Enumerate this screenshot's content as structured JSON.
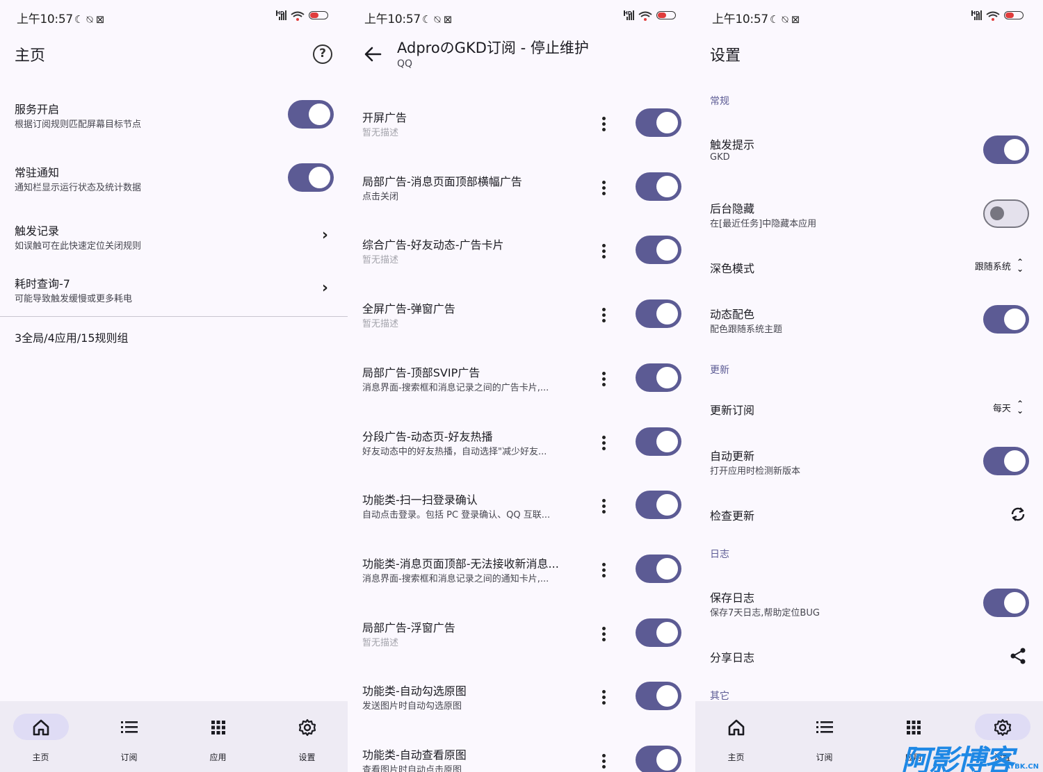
{
  "status": {
    "time": "上午10:57",
    "icons": "☾ ⍉ ⊠"
  },
  "screen1": {
    "title": "主页",
    "rows": [
      {
        "title": "服务开启",
        "sub": "根据订阅规则匹配屏幕目标节点",
        "control": "toggle-on"
      },
      {
        "title": "常驻通知",
        "sub": "通知栏显示运行状态及统计数据",
        "control": "toggle-on"
      },
      {
        "title": "触发记录",
        "sub": "如误触可在此快速定位关闭规则",
        "control": "chevron"
      },
      {
        "title": "耗时查询-7",
        "sub": "可能导致触发缓慢或更多耗电",
        "control": "chevron"
      }
    ],
    "summary": "3全局/4应用/15规则组"
  },
  "nav": {
    "items": [
      {
        "label": "主页",
        "icon": "home-icon"
      },
      {
        "label": "订阅",
        "icon": "list-icon"
      },
      {
        "label": "应用",
        "icon": "apps-grid-icon"
      },
      {
        "label": "设置",
        "icon": "settings-gear-icon"
      }
    ]
  },
  "screen2": {
    "title": "AdproのGKD订阅 - 停止维护",
    "subtitle": "QQ",
    "rules": [
      {
        "title": "开屏广告",
        "sub": "暂无描述",
        "grey": true
      },
      {
        "title": "局部广告-消息页面顶部横幅广告",
        "sub": "点击关闭",
        "grey": false
      },
      {
        "title": "综合广告-好友动态-广告卡片",
        "sub": "暂无描述",
        "grey": true
      },
      {
        "title": "全屏广告-弹窗广告",
        "sub": "暂无描述",
        "grey": true
      },
      {
        "title": "局部广告-顶部SVIP广告",
        "sub": "消息界面-搜索框和消息记录之间的广告卡片,...",
        "grey": false
      },
      {
        "title": "分段广告-动态页-好友热播",
        "sub": "好友动态中的好友热播，自动选择\"减少好友...",
        "grey": false
      },
      {
        "title": "功能类-扫一扫登录确认",
        "sub": "自动点击登录。包括 PC 登录确认、QQ 互联...",
        "grey": false
      },
      {
        "title": "功能类-消息页面顶部-无法接收新消息...",
        "sub": "消息界面-搜索框和消息记录之间的通知卡片,...",
        "grey": false
      },
      {
        "title": "局部广告-浮窗广告",
        "sub": "暂无描述",
        "grey": true
      },
      {
        "title": "功能类-自动勾选原图",
        "sub": "发送图片时自动勾选原图",
        "grey": false
      },
      {
        "title": "功能类-自动查看原图",
        "sub": "查看图片时自动点击原图",
        "grey": false
      }
    ]
  },
  "screen3": {
    "title": "设置",
    "sections": {
      "general": "常规",
      "update": "更新",
      "log": "日志",
      "other": "其它"
    },
    "trigger_tip": {
      "title": "触发提示",
      "sub": "GKD"
    },
    "hide_recent": {
      "title": "后台隐藏",
      "sub": "在[最近任务]中隐藏本应用"
    },
    "dark_mode": {
      "title": "深色模式",
      "value": "跟随系统"
    },
    "dynamic_color": {
      "title": "动态配色",
      "sub": "配色跟随系统主题"
    },
    "update_sub": {
      "title": "更新订阅",
      "value": "每天"
    },
    "auto_update": {
      "title": "自动更新",
      "sub": "打开应用时检测新版本"
    },
    "check_update": {
      "title": "检查更新"
    },
    "save_log": {
      "title": "保存日志",
      "sub": "保存7天日志,帮助定位BUG"
    },
    "share_log": {
      "title": "分享日志"
    }
  },
  "watermark": {
    "text": "阿影博客",
    "sub": "AYBK.CN"
  },
  "colors": {
    "accent": "#5c5b94",
    "background": "#fbf8fe",
    "navbar": "#eeebf4"
  }
}
